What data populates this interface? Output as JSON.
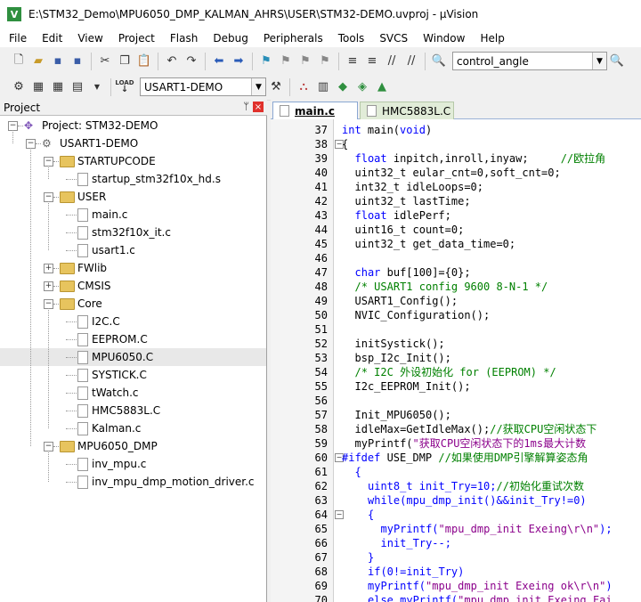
{
  "window": {
    "title": "E:\\STM32_Demo\\MPU6050_DMP_KALMAN_AHRS\\USER\\STM32-DEMO.uvproj - µVision",
    "app_icon_letter": "V"
  },
  "menu": [
    "File",
    "Edit",
    "View",
    "Project",
    "Flash",
    "Debug",
    "Peripherals",
    "Tools",
    "SVCS",
    "Window",
    "Help"
  ],
  "toolbar1": {
    "find_combo_value": "control_angle"
  },
  "toolbar2": {
    "target_combo_value": "USART1-DEMO",
    "load_label_top": "LOAD",
    "load_label_bottom": "↓"
  },
  "project_panel": {
    "title": "Project",
    "pin_glyph": "ᛘ",
    "close_glyph": "×",
    "tree": [
      {
        "label": "Project: STM32-DEMO",
        "type": "project",
        "level": 0,
        "expanded": true
      },
      {
        "label": "USART1-DEMO",
        "type": "target",
        "level": 1,
        "expanded": true
      },
      {
        "label": "STARTUPCODE",
        "type": "folder",
        "level": 2,
        "expanded": true
      },
      {
        "label": "startup_stm32f10x_hd.s",
        "type": "file",
        "level": 3
      },
      {
        "label": "USER",
        "type": "folder",
        "level": 2,
        "expanded": true
      },
      {
        "label": "main.c",
        "type": "file",
        "level": 3
      },
      {
        "label": "stm32f10x_it.c",
        "type": "file",
        "level": 3
      },
      {
        "label": "usart1.c",
        "type": "file",
        "level": 3
      },
      {
        "label": "FWlib",
        "type": "folder",
        "level": 2,
        "expanded": false
      },
      {
        "label": "CMSIS",
        "type": "folder",
        "level": 2,
        "expanded": false
      },
      {
        "label": "Core",
        "type": "folder",
        "level": 2,
        "expanded": true
      },
      {
        "label": "I2C.C",
        "type": "file",
        "level": 3
      },
      {
        "label": "EEPROM.C",
        "type": "file",
        "level": 3
      },
      {
        "label": "MPU6050.C",
        "type": "file",
        "level": 3,
        "selected": true
      },
      {
        "label": "SYSTICK.C",
        "type": "file",
        "level": 3
      },
      {
        "label": "tWatch.c",
        "type": "file",
        "level": 3
      },
      {
        "label": "HMC5883L.C",
        "type": "file",
        "level": 3
      },
      {
        "label": "Kalman.c",
        "type": "file",
        "level": 3
      },
      {
        "label": "MPU6050_DMP",
        "type": "folder",
        "level": 2,
        "expanded": true
      },
      {
        "label": "inv_mpu.c",
        "type": "file",
        "level": 3
      },
      {
        "label": "inv_mpu_dmp_motion_driver.c",
        "type": "file",
        "level": 3
      }
    ]
  },
  "editor": {
    "tabs": [
      {
        "label": "main.c",
        "active": true
      },
      {
        "label": "HMC5883L.C",
        "active": false
      }
    ],
    "lines": [
      {
        "n": "37",
        "fold": "",
        "indent": 0,
        "parts": [
          [
            "kw",
            "int"
          ],
          [
            "nm",
            " main("
          ],
          [
            "kw",
            "void"
          ],
          [
            "nm",
            ")"
          ]
        ]
      },
      {
        "n": "38",
        "fold": "-",
        "indent": 0,
        "parts": [
          [
            "nm",
            "{"
          ]
        ]
      },
      {
        "n": "39",
        "fold": "",
        "indent": 2,
        "parts": [
          [
            "kw",
            "float"
          ],
          [
            "nm",
            " inpitch,inroll,inyaw;     "
          ],
          [
            "cm",
            "//欧拉角"
          ]
        ]
      },
      {
        "n": "40",
        "fold": "",
        "indent": 2,
        "parts": [
          [
            "nm",
            "uint32_t eular_cnt="
          ],
          [
            "nm",
            "0"
          ],
          [
            "nm",
            ",soft_cnt="
          ],
          [
            "nm",
            "0"
          ],
          [
            "nm",
            ";"
          ]
        ]
      },
      {
        "n": "41",
        "fold": "",
        "indent": 2,
        "parts": [
          [
            "nm",
            "int32_t idleLoops="
          ],
          [
            "nm",
            "0"
          ],
          [
            "nm",
            ";"
          ]
        ]
      },
      {
        "n": "42",
        "fold": "",
        "indent": 2,
        "parts": [
          [
            "nm",
            "uint32_t lastTime;"
          ]
        ]
      },
      {
        "n": "43",
        "fold": "",
        "indent": 2,
        "parts": [
          [
            "kw",
            "float"
          ],
          [
            "nm",
            " idlePerf;"
          ]
        ]
      },
      {
        "n": "44",
        "fold": "",
        "indent": 2,
        "parts": [
          [
            "nm",
            "uint16_t count="
          ],
          [
            "nm",
            "0"
          ],
          [
            "nm",
            ";"
          ]
        ]
      },
      {
        "n": "45",
        "fold": "",
        "indent": 2,
        "parts": [
          [
            "nm",
            "uint32_t get_data_time="
          ],
          [
            "nm",
            "0"
          ],
          [
            "nm",
            ";"
          ]
        ]
      },
      {
        "n": "46",
        "fold": "",
        "indent": 0,
        "parts": []
      },
      {
        "n": "47",
        "fold": "",
        "indent": 2,
        "parts": [
          [
            "kw",
            "char"
          ],
          [
            "nm",
            " buf[100]={0};"
          ]
        ]
      },
      {
        "n": "48",
        "fold": "",
        "indent": 2,
        "parts": [
          [
            "cm",
            "/* USART1 config 9600 8-N-1 */"
          ]
        ]
      },
      {
        "n": "49",
        "fold": "",
        "indent": 2,
        "parts": [
          [
            "nm",
            "USART1_Config();"
          ]
        ]
      },
      {
        "n": "50",
        "fold": "",
        "indent": 2,
        "parts": [
          [
            "nm",
            "NVIC_Configuration();"
          ]
        ]
      },
      {
        "n": "51",
        "fold": "",
        "indent": 0,
        "parts": []
      },
      {
        "n": "52",
        "fold": "",
        "indent": 2,
        "parts": [
          [
            "nm",
            "initSystick();"
          ]
        ]
      },
      {
        "n": "53",
        "fold": "",
        "indent": 2,
        "parts": [
          [
            "nm",
            "bsp_I2c_Init();"
          ]
        ]
      },
      {
        "n": "54",
        "fold": "",
        "indent": 2,
        "parts": [
          [
            "cm",
            "/* I2C 外设初始化 for (EEPROM) */"
          ]
        ]
      },
      {
        "n": "55",
        "fold": "",
        "indent": 2,
        "parts": [
          [
            "nm",
            "I2c_EEPROM_Init();"
          ]
        ]
      },
      {
        "n": "56",
        "fold": "",
        "indent": 0,
        "parts": []
      },
      {
        "n": "57",
        "fold": "",
        "indent": 2,
        "parts": [
          [
            "nm",
            "Init_MPU6050();"
          ]
        ]
      },
      {
        "n": "58",
        "fold": "",
        "indent": 2,
        "parts": [
          [
            "nm",
            "idleMax=GetIdleMax();"
          ],
          [
            "cm",
            "//获取CPU空闲状态下"
          ]
        ]
      },
      {
        "n": "59",
        "fold": "",
        "indent": 2,
        "parts": [
          [
            "nm",
            "myPrintf("
          ],
          [
            "st",
            "\"获取CPU空闲状态下的1ms最大计数"
          ]
        ]
      },
      {
        "n": "60",
        "fold": "-",
        "indent": 0,
        "parts": [
          [
            "kw",
            "#ifdef"
          ],
          [
            "nm",
            " USE_DMP "
          ],
          [
            "cm",
            "//如果使用DMP引擎解算姿态角"
          ]
        ]
      },
      {
        "n": "61",
        "fold": "",
        "indent": 2,
        "parts": [
          [
            "kw",
            "{"
          ]
        ]
      },
      {
        "n": "62",
        "fold": "",
        "indent": 4,
        "parts": [
          [
            "kw",
            "uint8_t init_Try=10;"
          ],
          [
            "cm",
            "//初始化重试次数"
          ]
        ]
      },
      {
        "n": "63",
        "fold": "",
        "indent": 4,
        "parts": [
          [
            "kw",
            "while(mpu_dmp_init()&&init_Try!=0)"
          ]
        ]
      },
      {
        "n": "64",
        "fold": "-",
        "indent": 4,
        "parts": [
          [
            "kw",
            "{"
          ]
        ]
      },
      {
        "n": "65",
        "fold": "",
        "indent": 6,
        "parts": [
          [
            "kw",
            "myPrintf("
          ],
          [
            "st",
            "\"mpu_dmp_init Exeing\\r\\n\""
          ],
          [
            "kw",
            ");"
          ]
        ]
      },
      {
        "n": "66",
        "fold": "",
        "indent": 6,
        "parts": [
          [
            "kw",
            "init_Try--;"
          ]
        ]
      },
      {
        "n": "67",
        "fold": "",
        "indent": 4,
        "parts": [
          [
            "kw",
            "}"
          ]
        ]
      },
      {
        "n": "68",
        "fold": "",
        "indent": 4,
        "parts": [
          [
            "kw",
            "if(0!=init_Try)"
          ]
        ]
      },
      {
        "n": "69",
        "fold": "",
        "indent": 4,
        "parts": [
          [
            "kw",
            "myPrintf("
          ],
          [
            "st",
            "\"mpu_dmp_init Exeing ok\\r\\n\""
          ],
          [
            "kw",
            ")"
          ]
        ]
      },
      {
        "n": "70",
        "fold": "",
        "indent": 4,
        "parts": [
          [
            "kw",
            "else myPrintf("
          ],
          [
            "st",
            "\"mpu_dmp_init Exeing Fai"
          ]
        ]
      }
    ]
  }
}
